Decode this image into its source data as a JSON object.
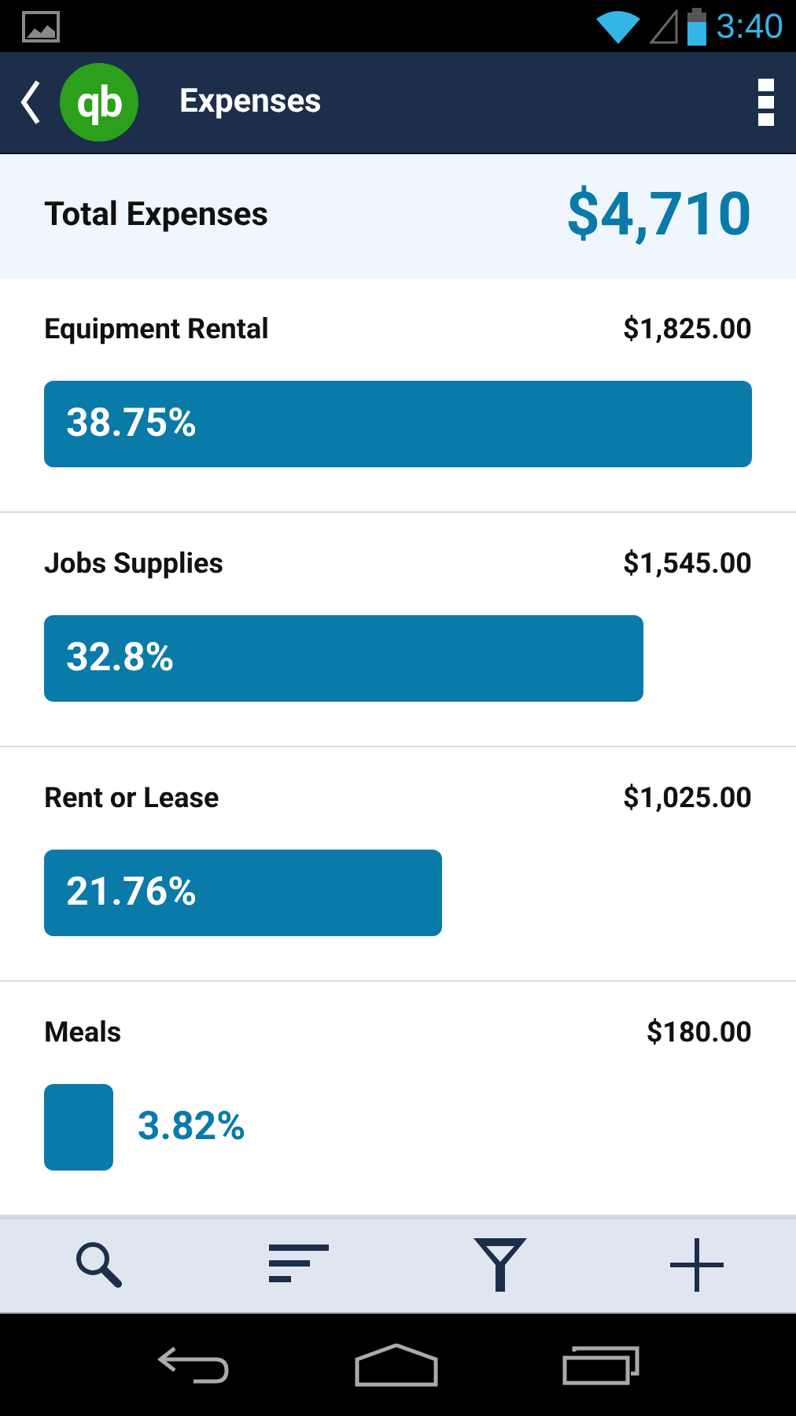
{
  "status_bar": {
    "time": "3:40"
  },
  "app_bar": {
    "logo": "qb",
    "title": "Expenses"
  },
  "total": {
    "label": "Total Expenses",
    "amount": "$4,710"
  },
  "expenses": [
    {
      "name": "Equipment Rental",
      "amount": "$1,825.00",
      "percent": "38.75%"
    },
    {
      "name": "Jobs Supplies",
      "amount": "$1,545.00",
      "percent": "32.8%"
    },
    {
      "name": "Rent or Lease",
      "amount": "$1,025.00",
      "percent": "21.76%"
    },
    {
      "name": "Meals",
      "amount": "$180.00",
      "percent": "3.82%"
    }
  ],
  "toolbar": [
    {
      "kind": "search"
    },
    {
      "kind": "sort"
    },
    {
      "kind": "filter"
    },
    {
      "kind": "add"
    }
  ]
}
